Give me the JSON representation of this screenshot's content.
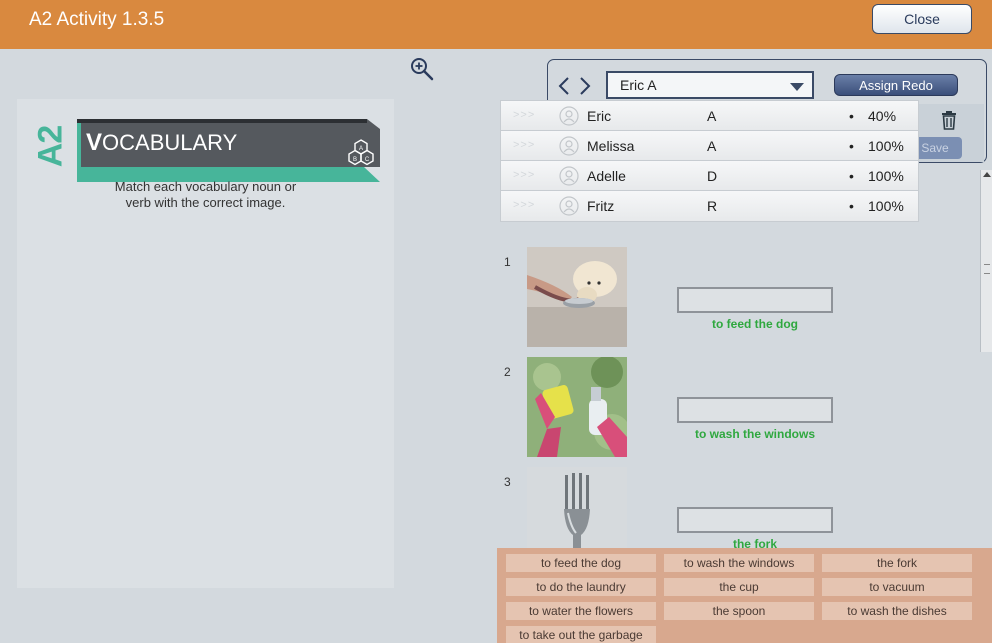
{
  "window": {
    "title": "A2 Activity 1.3.5",
    "close_label": "Close"
  },
  "colors": {
    "header": "#d9893f",
    "accent_green": "#2fa83f",
    "teal": "#47b59a"
  },
  "left_panel": {
    "badge": "A2",
    "banner_cap": "V",
    "banner_rest": "OCABULARY",
    "instructions_line1": "Match each vocabulary noun or",
    "instructions_line2": "verb with the correct image."
  },
  "toolbar": {
    "selected_student": "Eric A",
    "assign_redo_label": "Assign Redo",
    "save_label": "Save"
  },
  "students": [
    {
      "chevrons": ">>>",
      "name": "Eric",
      "initial": "A",
      "dot": "•",
      "score": "40%"
    },
    {
      "chevrons": ">>>",
      "name": "Melissa",
      "initial": "A",
      "dot": "•",
      "score": "100%"
    },
    {
      "chevrons": ">>>",
      "name": "Adelle",
      "initial": "D",
      "dot": "•",
      "score": "100%"
    },
    {
      "chevrons": ">>>",
      "name": "Fritz",
      "initial": "R",
      "dot": "•",
      "score": "100%"
    }
  ],
  "questions": [
    {
      "number": "1",
      "answer": "to feed the dog"
    },
    {
      "number": "2",
      "answer": "to wash the windows"
    },
    {
      "number": "3",
      "answer": "the fork"
    }
  ],
  "word_bank": [
    "to feed the dog",
    "to wash the windows",
    "the fork",
    "to do the laundry",
    "the cup",
    "to vacuum",
    "to water the flowers",
    "the spoon",
    "to wash the dishes",
    "to take out the garbage"
  ]
}
